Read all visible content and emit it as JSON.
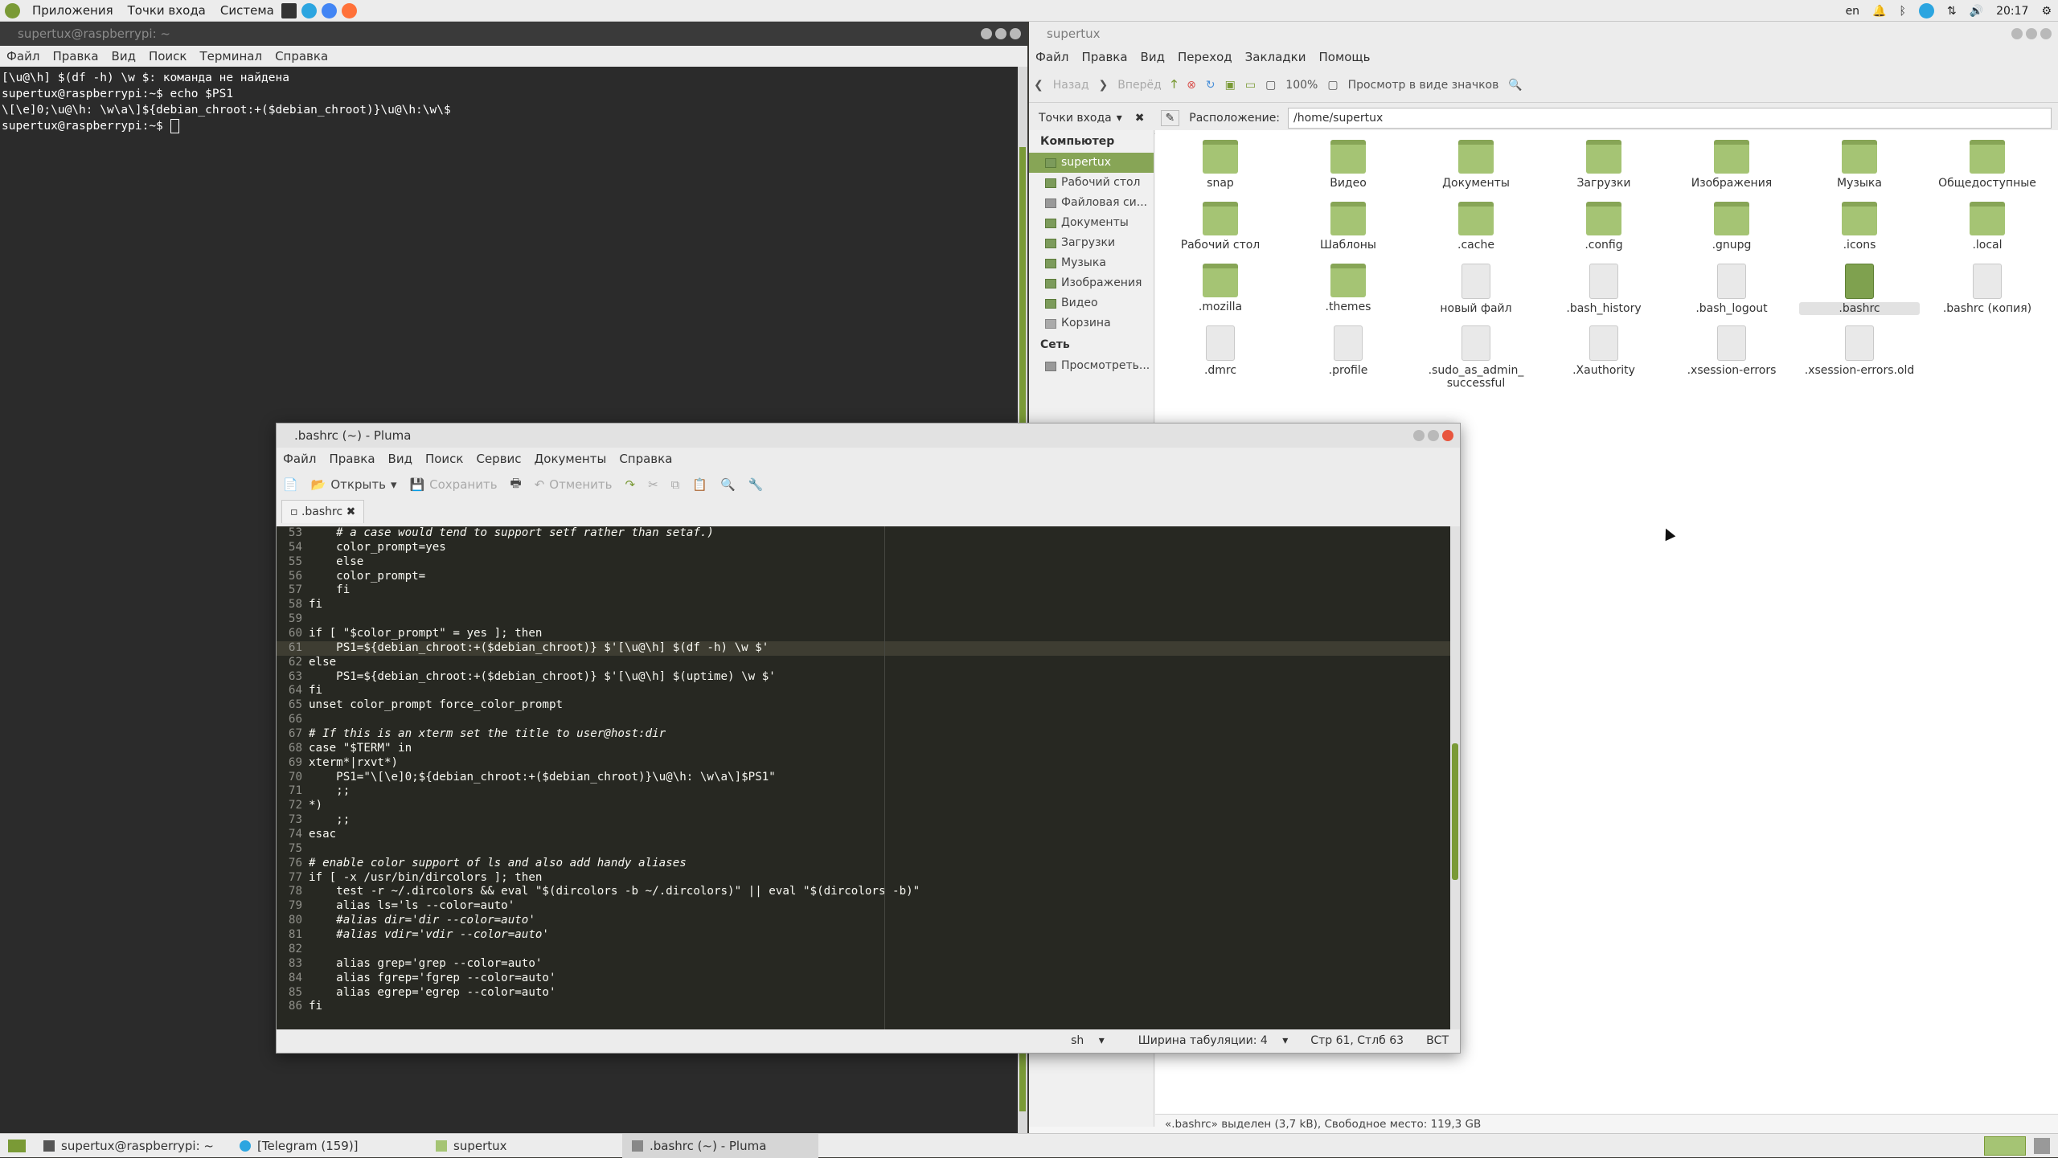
{
  "top_panel": {
    "menus": [
      "Приложения",
      "Точки входа",
      "Система"
    ],
    "lang": "en",
    "clock": "20:17"
  },
  "terminal": {
    "title": "supertux@raspberrypi: ~",
    "menu": [
      "Файл",
      "Правка",
      "Вид",
      "Поиск",
      "Терминал",
      "Справка"
    ],
    "lines": [
      "[\\u@\\h] $(df -h) \\w $: команда не найдена",
      "supertux@raspberrypi:~$ echo $PS1",
      "\\[\\e]0;\\u@\\h: \\w\\a\\]${debian_chroot:+($debian_chroot)}\\u@\\h:\\w\\$",
      "supertux@raspberrypi:~$ "
    ]
  },
  "caja": {
    "title": "supertux",
    "menu": [
      "Файл",
      "Правка",
      "Вид",
      "Переход",
      "Закладки",
      "Помощь"
    ],
    "toolbar": {
      "back": "Назад",
      "forward": "Вперёд",
      "zoom": "100%",
      "view": "Просмотр в виде значков"
    },
    "places_label": "Точки входа",
    "location_label": "Расположение:",
    "location": "/home/supertux",
    "sidebar": {
      "computer": "Компьютер",
      "items": [
        "supertux",
        "Рабочий стол",
        "Файловая си...",
        "Документы",
        "Загрузки",
        "Музыка",
        "Изображения",
        "Видео",
        "Корзина"
      ],
      "network": "Сеть",
      "network_items": [
        "Просмотреть..."
      ]
    },
    "files": [
      {
        "name": "snap",
        "kind": "folder"
      },
      {
        "name": "Видео",
        "kind": "folder"
      },
      {
        "name": "Документы",
        "kind": "folder"
      },
      {
        "name": "Загрузки",
        "kind": "folder"
      },
      {
        "name": "Изображения",
        "kind": "folder"
      },
      {
        "name": "Музыка",
        "kind": "folder"
      },
      {
        "name": "Общедоступные",
        "kind": "folder"
      },
      {
        "name": "Рабочий стол",
        "kind": "folder"
      },
      {
        "name": "Шаблоны",
        "kind": "folder"
      },
      {
        "name": ".cache",
        "kind": "folder"
      },
      {
        "name": ".config",
        "kind": "folder"
      },
      {
        "name": ".gnupg",
        "kind": "folder"
      },
      {
        "name": ".icons",
        "kind": "folder"
      },
      {
        "name": ".local",
        "kind": "folder"
      },
      {
        "name": ".mozilla",
        "kind": "folder"
      },
      {
        "name": ".themes",
        "kind": "folder"
      },
      {
        "name": "новый файл",
        "kind": "doc"
      },
      {
        "name": ".bash_history",
        "kind": "doc"
      },
      {
        "name": ".bash_logout",
        "kind": "doc"
      },
      {
        "name": ".bashrc",
        "kind": "doc-selected"
      },
      {
        "name": ".bashrc (копия)",
        "kind": "doc"
      },
      {
        "name": ".dmrc",
        "kind": "doc"
      },
      {
        "name": ".profile",
        "kind": "doc"
      },
      {
        "name": ".sudo_as_admin_ successful",
        "kind": "doc"
      },
      {
        "name": ".Xauthority",
        "kind": "doc"
      },
      {
        "name": ".xsession-errors",
        "kind": "doc"
      },
      {
        "name": ".xsession-errors.old",
        "kind": "doc"
      }
    ],
    "status": "«.bashrc» выделен (3,7 kB), Свободное место: 119,3 GB"
  },
  "pluma": {
    "title": ".bashrc (~) - Pluma",
    "menu": [
      "Файл",
      "Правка",
      "Вид",
      "Поиск",
      "Сервис",
      "Документы",
      "Справка"
    ],
    "toolbar": {
      "open": "Открыть",
      "save": "Сохранить",
      "undo": "Отменить"
    },
    "tab": ".bashrc",
    "status": {
      "lang": "sh",
      "tab_width": "Ширина табуляции:  4",
      "position": "Стр 61, Стлб 63",
      "mode": "ВСТ"
    },
    "first_line": 53,
    "current_line": 61,
    "code": [
      "    # a case would tend to support setf rather than setaf.)",
      "    color_prompt=yes",
      "    else",
      "    color_prompt=",
      "    fi",
      "fi",
      "",
      "if [ \"$color_prompt\" = yes ]; then",
      "    PS1=${debian_chroot:+($debian_chroot)} $'[\\u@\\h] $(df -h) \\w $'",
      "else",
      "    PS1=${debian_chroot:+($debian_chroot)} $'[\\u@\\h] $(uptime) \\w $'",
      "fi",
      "unset color_prompt force_color_prompt",
      "",
      "# If this is an xterm set the title to user@host:dir",
      "case \"$TERM\" in",
      "xterm*|rxvt*)",
      "    PS1=\"\\[\\e]0;${debian_chroot:+($debian_chroot)}\\u@\\h: \\w\\a\\]$PS1\"",
      "    ;;",
      "*)",
      "    ;;",
      "esac",
      "",
      "# enable color support of ls and also add handy aliases",
      "if [ -x /usr/bin/dircolors ]; then",
      "    test -r ~/.dircolors && eval \"$(dircolors -b ~/.dircolors)\" || eval \"$(dircolors -b)\"",
      "    alias ls='ls --color=auto'",
      "    #alias dir='dir --color=auto'",
      "    #alias vdir='vdir --color=auto'",
      "",
      "    alias grep='grep --color=auto'",
      "    alias fgrep='fgrep --color=auto'",
      "    alias egrep='egrep --color=auto'",
      "fi"
    ]
  },
  "taskbar": {
    "tasks": [
      "supertux@raspberrypi: ~",
      "[Telegram (159)]",
      "supertux",
      ".bashrc (~) - Pluma"
    ]
  }
}
